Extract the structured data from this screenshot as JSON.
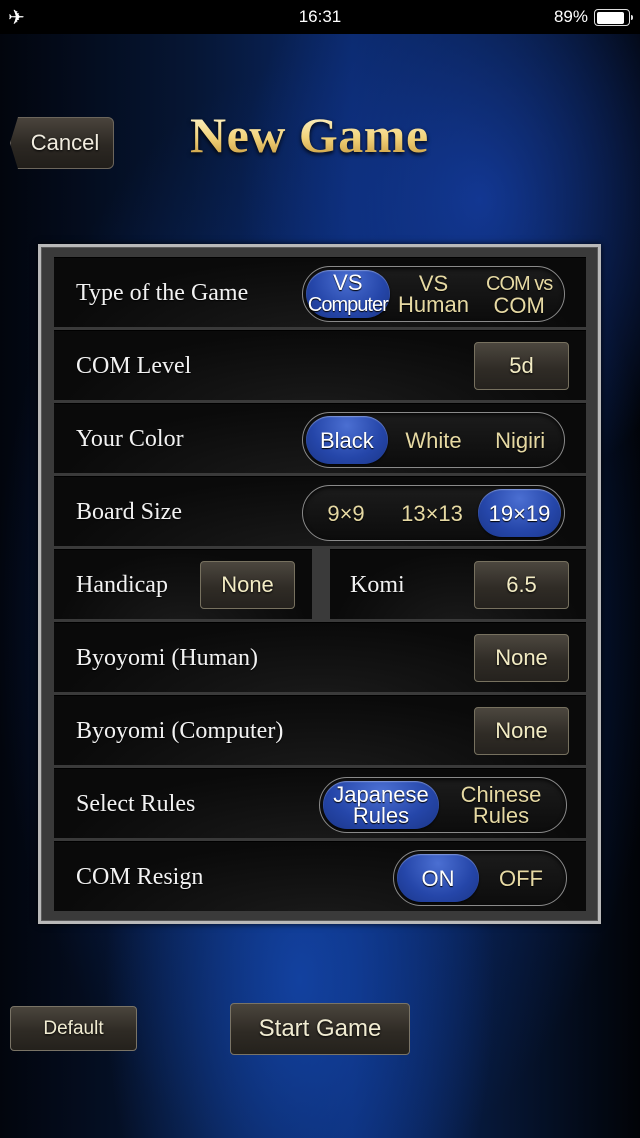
{
  "status_bar": {
    "airplane_icon": "airplane-icon",
    "time": "16:31",
    "battery_percent": "89%",
    "battery_level": 0.89
  },
  "header": {
    "cancel_label": "Cancel",
    "title": "New Game"
  },
  "settings": {
    "game_type": {
      "label": "Type of the Game",
      "options": [
        {
          "line1": "VS",
          "line2": "Computer",
          "selected": true
        },
        {
          "line1": "VS",
          "line2": "Human",
          "selected": false
        },
        {
          "line1": "COM vs",
          "line2": "COM",
          "selected": false
        }
      ]
    },
    "com_level": {
      "label": "COM Level",
      "value": "5d"
    },
    "your_color": {
      "label": "Your Color",
      "options": [
        {
          "text": "Black",
          "selected": true
        },
        {
          "text": "White",
          "selected": false
        },
        {
          "text": "Nigiri",
          "selected": false
        }
      ]
    },
    "board_size": {
      "label": "Board Size",
      "options": [
        {
          "text": "9×9",
          "selected": false
        },
        {
          "text": "13×13",
          "selected": false
        },
        {
          "text": "19×19",
          "selected": true
        }
      ]
    },
    "handicap": {
      "label": "Handicap",
      "value": "None"
    },
    "komi": {
      "label": "Komi",
      "value": "6.5"
    },
    "byoyomi_human": {
      "label": "Byoyomi (Human)",
      "value": "None"
    },
    "byoyomi_computer": {
      "label": "Byoyomi (Computer)",
      "value": "None"
    },
    "rules": {
      "label": "Select Rules",
      "options": [
        {
          "line1": "Japanese",
          "line2": "Rules",
          "selected": true
        },
        {
          "line1": "Chinese",
          "line2": "Rules",
          "selected": false
        }
      ]
    },
    "com_resign": {
      "label": "COM Resign",
      "options": [
        {
          "text": "ON",
          "selected": true
        },
        {
          "text": "OFF",
          "selected": false
        }
      ]
    }
  },
  "footer": {
    "default_label": "Default",
    "start_label": "Start Game"
  }
}
